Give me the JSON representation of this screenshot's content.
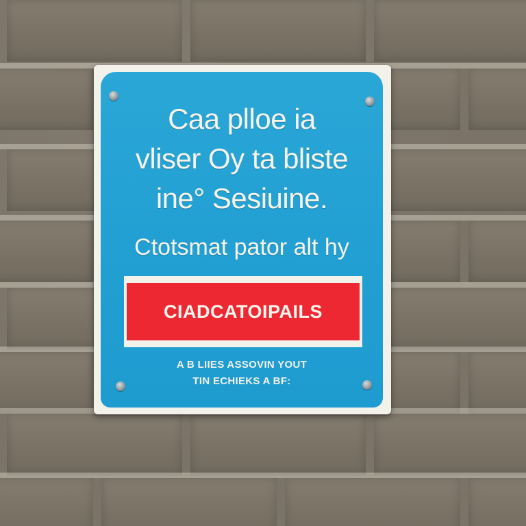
{
  "wall": {
    "brick_color": "#7b7367",
    "mortar_color": "#c9c3b6"
  },
  "sign": {
    "frame_color": "#f3f2ea",
    "panel_color": "#22a0d3",
    "banner_color": "#ee2833",
    "heading_lines": [
      "Caa plloe ia",
      "vliser Oy ta bliste",
      "ine° Sesiuine."
    ],
    "subheading": "Ctotsmat pator alt hy",
    "banner_text": "CIADCATOIPAILS",
    "fine_print_lines": [
      "A B LIIES ASSOVIN YOUT",
      "TIN ECHIEKS A BF:"
    ]
  }
}
